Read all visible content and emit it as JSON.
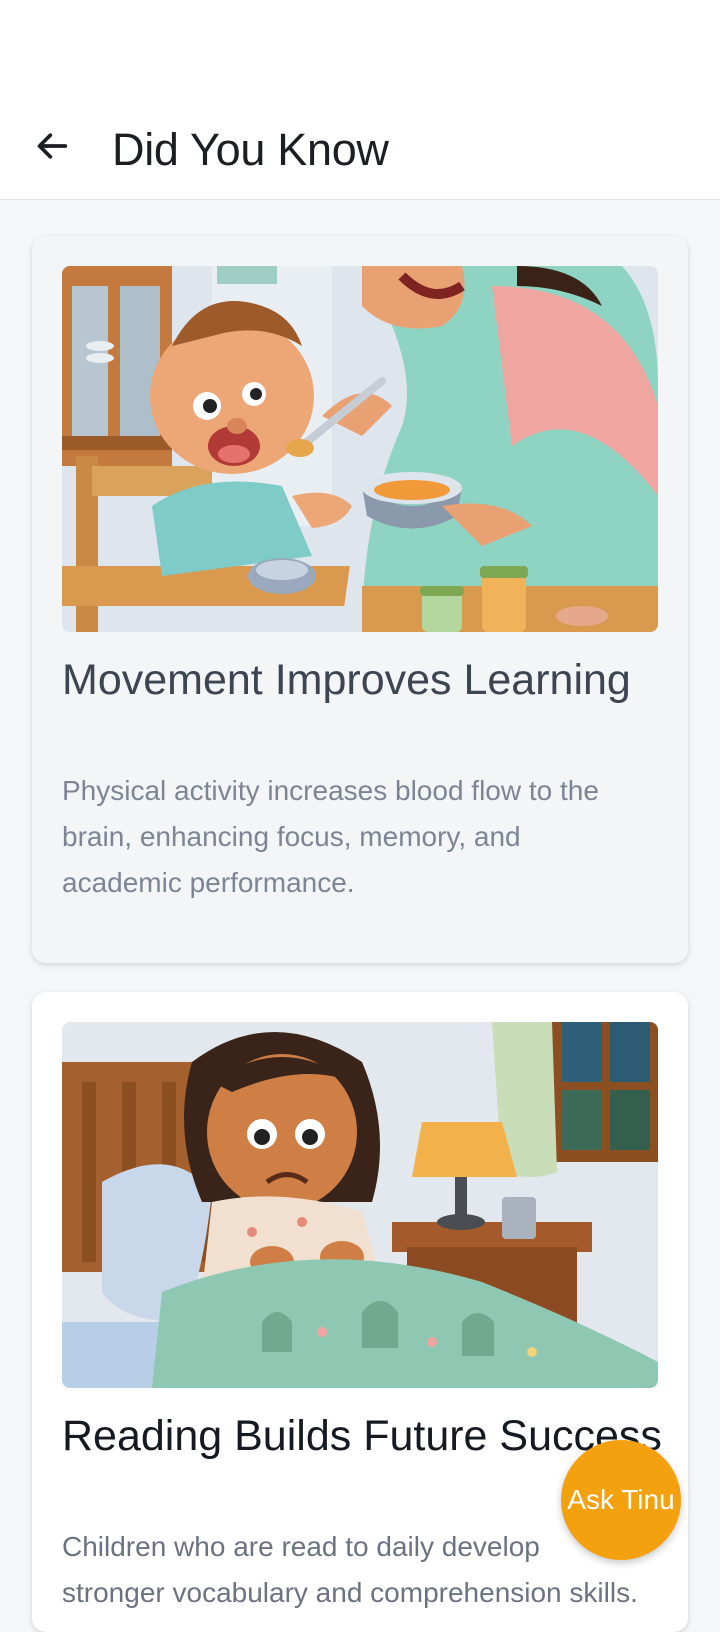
{
  "header": {
    "title": "Did You Know",
    "back_icon": "arrow-left-icon"
  },
  "cards": [
    {
      "title": "Movement Improves Learning",
      "body": "Physical activity increases blood flow to the brain, enhancing focus, memory, and academic performance.",
      "image": "illustration-mother-feeding-baby"
    },
    {
      "title": "Reading Builds Future Success",
      "body": "Children who are read to daily develop stronger vocabulary and comprehension skills.",
      "image": "illustration-girl-scared-in-bed"
    }
  ],
  "fab": {
    "label": "Ask Tinu",
    "color": "#f4a10f"
  },
  "colors": {
    "background": "#f4f6f8",
    "accent": "#f4a10f"
  }
}
